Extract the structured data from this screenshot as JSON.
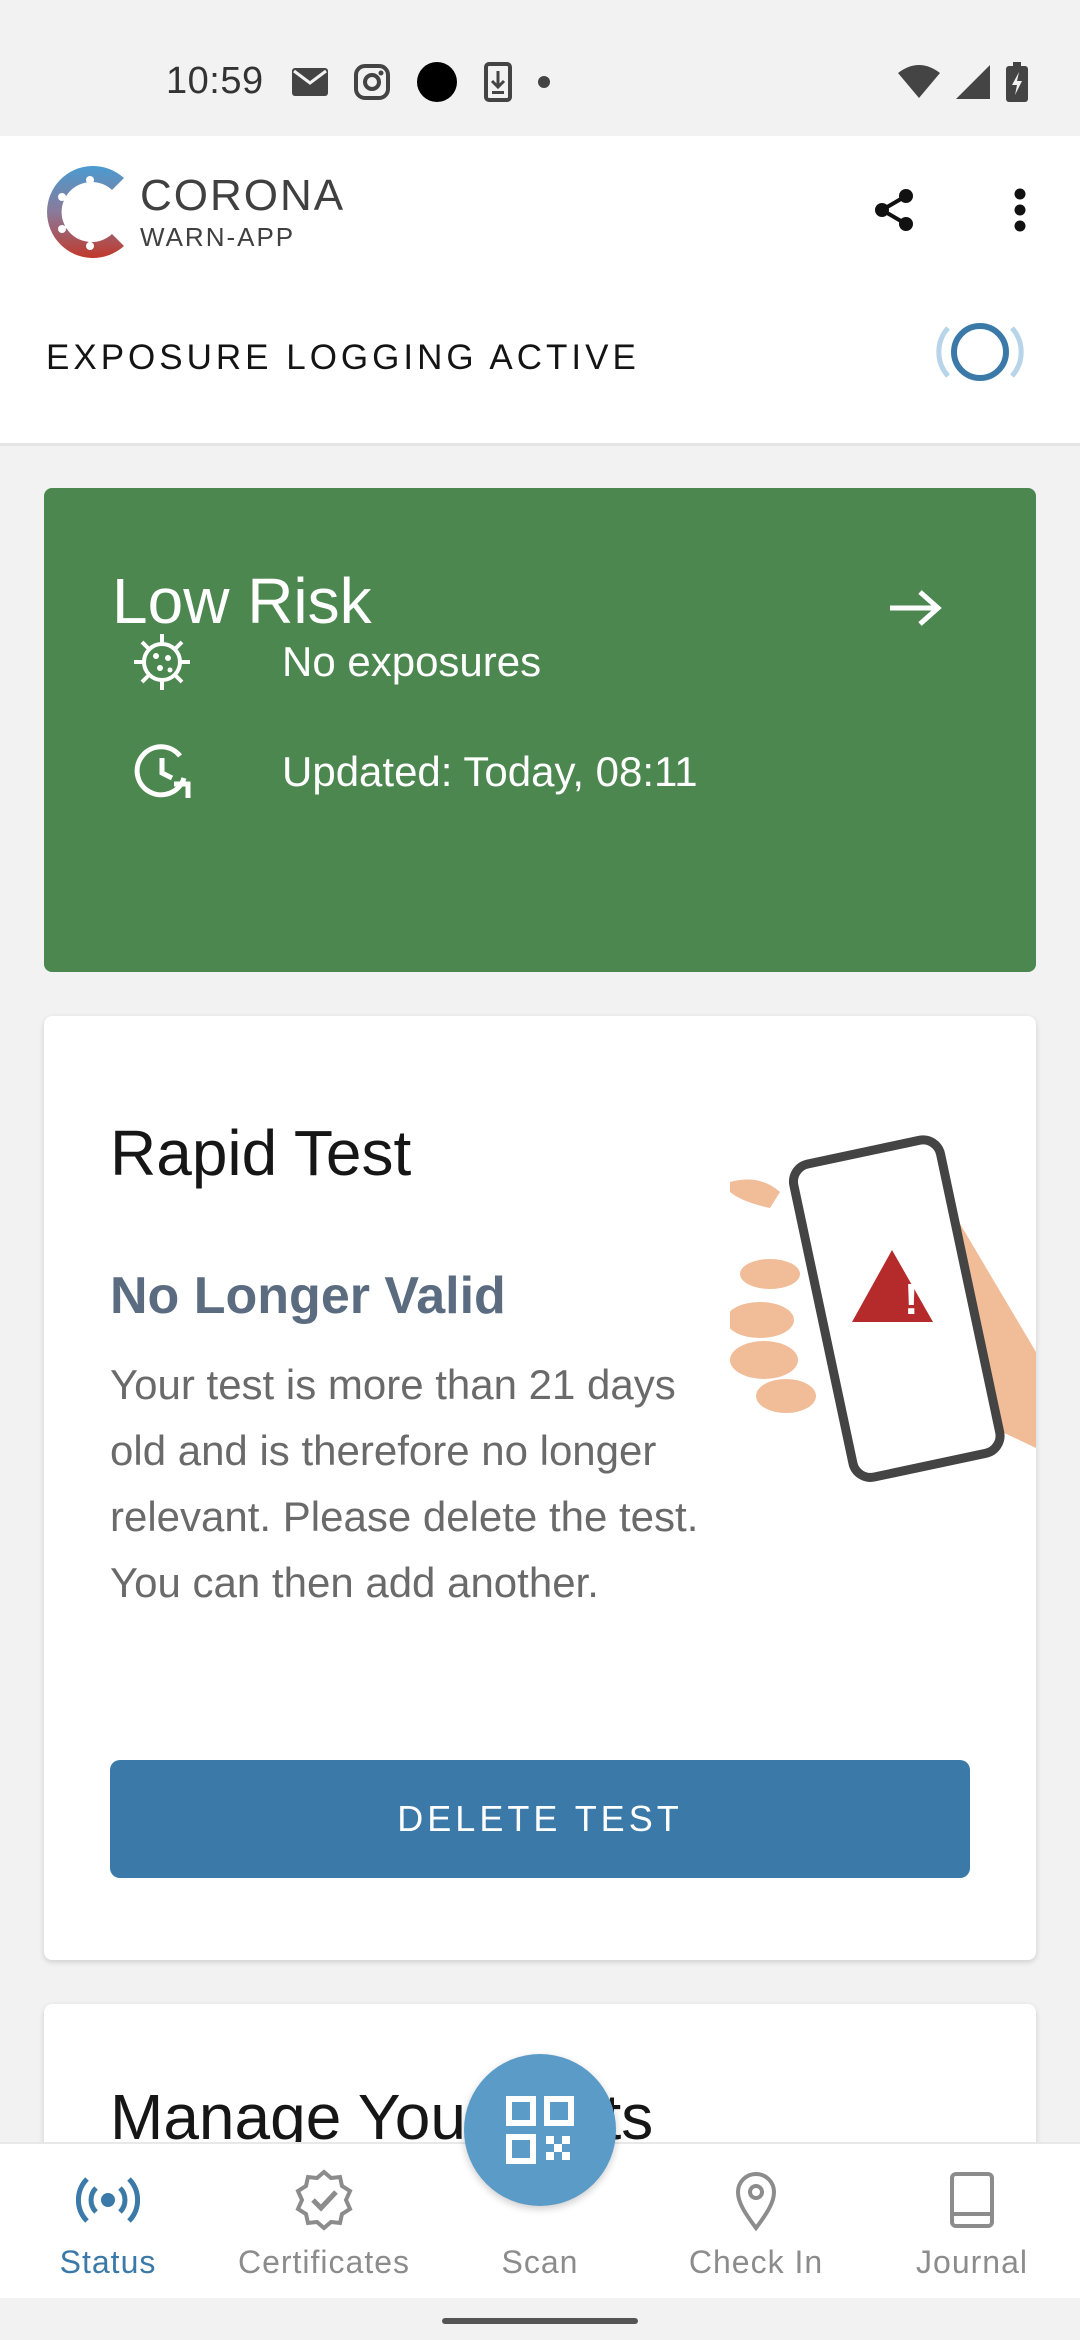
{
  "status_bar": {
    "time": "10:59",
    "left_icons": [
      "gmail-icon",
      "instagram-icon",
      "dot-icon",
      "download-icon",
      "small-dot-icon"
    ],
    "right_icons": [
      "wifi-icon",
      "signal-icon",
      "battery-icon"
    ]
  },
  "header": {
    "logo_line1": "CORONA",
    "logo_line2": "WARN-APP",
    "share_icon": "share-icon",
    "more_icon": "more-vert-icon",
    "exposure_label": "EXPOSURE LOGGING ACTIVE"
  },
  "risk_card": {
    "title": "Low Risk",
    "color": "#4d8750",
    "rows": [
      {
        "icon": "virus-icon",
        "text": "No exposures"
      },
      {
        "icon": "clock-refresh-icon",
        "text": "Updated: Today, 08:11"
      }
    ]
  },
  "test_card": {
    "title": "Rapid Test",
    "status": "No Longer Valid",
    "body": "Your test is more than 21 days old and is therefore no longer relevant. Please delete the test. You can then add another.",
    "button_label": "DELETE TEST"
  },
  "manage_card": {
    "title": "Manage Your Tests"
  },
  "bottom_nav": {
    "items": [
      {
        "label": "Status",
        "icon": "broadcast-icon",
        "active": true
      },
      {
        "label": "Certificates",
        "icon": "certificate-icon",
        "active": false
      },
      {
        "label": "Scan",
        "icon": "qr-code-icon",
        "active": false
      },
      {
        "label": "Check In",
        "icon": "location-pin-icon",
        "active": false
      },
      {
        "label": "Journal",
        "icon": "book-icon",
        "active": false
      }
    ]
  },
  "colors": {
    "accent": "#3b7aa8",
    "risk_green": "#4d8750",
    "fab": "#5b9bc8"
  }
}
